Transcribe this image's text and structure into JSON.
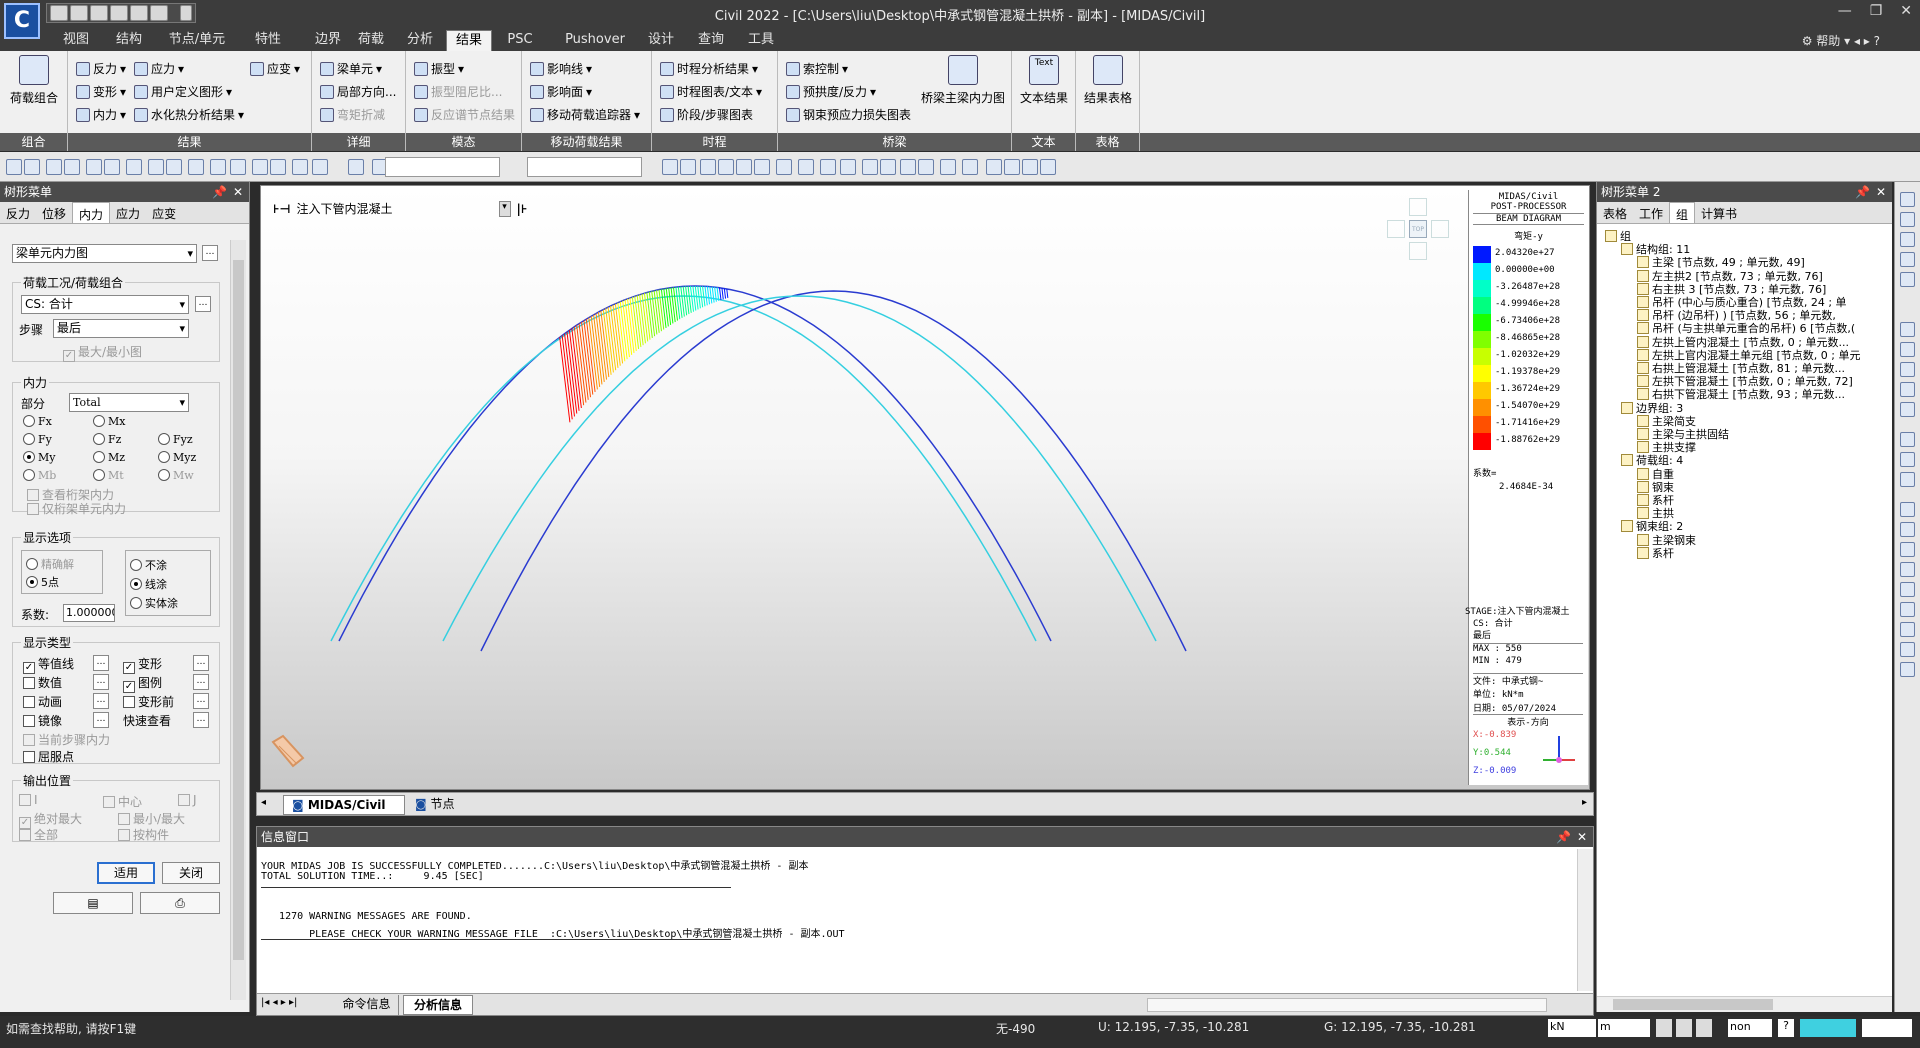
{
  "window": {
    "title": "Civil 2022 - [C:\\Users\\liu\\Desktop\\中承式钢管混凝土拱桥 - 副本] - [MIDAS/Civil]",
    "logo": "C"
  },
  "menu_tabs": [
    "视图",
    "结构",
    "节点/单元",
    "特性",
    "边界",
    "荷载",
    "分析",
    "结果",
    "PSC",
    "Pushover",
    "设计",
    "查询",
    "工具"
  ],
  "active_tab": "结果",
  "help_label": "帮助",
  "ribbon": {
    "groups": [
      {
        "label": "组合",
        "items": [
          "荷载组合"
        ]
      },
      {
        "label": "结果",
        "items": [
          "反力",
          "应力",
          "应变",
          "变形",
          "用户定义图形",
          "内力",
          "水化热分析结果"
        ]
      },
      {
        "label": "详细",
        "items": [
          "梁单元",
          "局部方向...",
          "弯矩折减"
        ]
      },
      {
        "label": "模态",
        "items": [
          "振型",
          "振型阻尼比...",
          "反应谱节点结果"
        ]
      },
      {
        "label": "移动荷载结果",
        "items": [
          "影响线",
          "影响面",
          "移动荷载追踪器"
        ]
      },
      {
        "label": "时程",
        "items": [
          "时程分析结果",
          "时程图表/文本",
          "阶段/步骤图表"
        ]
      },
      {
        "label": "桥梁",
        "items": [
          "索控制",
          "预拱度/反力",
          "钢束预应力损失图表",
          "桥梁主梁内力图"
        ]
      },
      {
        "label": "文本",
        "items": [
          "文本结果"
        ]
      },
      {
        "label": "表格",
        "items": [
          "结果表格"
        ]
      }
    ],
    "text_icon_label": "Text"
  },
  "left_panel": {
    "title": "树形菜单",
    "tabs": [
      "反力",
      "位移",
      "内力",
      "应力",
      "应变"
    ],
    "active_tab": "内力",
    "diagram_type": "梁单元内力图",
    "load_section": "荷载工况/荷载组合",
    "load_case": "CS: 合计",
    "step_label": "步骤",
    "step_value": "最后",
    "maxmin_label": "最大/最小图",
    "internal_force_label": "内力",
    "part_label": "部分",
    "part_value": "Total",
    "components": [
      "Fx",
      "Mx",
      "Fy",
      "Fz",
      "Fyz",
      "My",
      "Mz",
      "Myz",
      "Mb",
      "Mt",
      "Mw"
    ],
    "selected_component": "My",
    "truss_force": "查看桁架内力",
    "truss_only": "仅桁架单元内力",
    "display_options_label": "显示选项",
    "precise": "精确解",
    "five_points": "5点",
    "fill_none": "不涂",
    "fill_line": "线涂",
    "fill_solid": "实体涂",
    "scale_label": "系数:",
    "scale_value": "1.000000",
    "display_type_label": "显示类型",
    "contour": "等值线",
    "deformed": "变形",
    "values": "数值",
    "legend": "图例",
    "animation": "动画",
    "undeformed": "变形前",
    "mirror": "镜像",
    "quick_view": "快速查看",
    "current_step_force": "当前步骤内力",
    "yield_point": "屈服点",
    "output_position_label": "输出位置",
    "pos_i": "I",
    "pos_center": "中心",
    "pos_j": "J",
    "abs_max": "绝对最大",
    "min_max": "最小/最大",
    "all": "全部",
    "by_member": "按构件",
    "apply_btn": "适用",
    "close_btn": "关闭"
  },
  "toolbar": {
    "combo1": "",
    "combo2": ""
  },
  "viewport": {
    "stage_label": "注入下管内混凝土",
    "tabs": [
      "MIDAS/Civil",
      "节点"
    ],
    "active_tab": "MIDAS/Civil"
  },
  "legend_panel": {
    "header1": "MIDAS/Civil",
    "header2": "POST-PROCESSOR",
    "header3": "BEAM DIAGRAM",
    "component": "弯矩-y",
    "values": [
      "2.04320e+27",
      "0.00000e+00",
      "-3.26487e+28",
      "-4.99946e+28",
      "-6.73406e+28",
      "-8.46865e+28",
      "-1.02032e+29",
      "-1.19378e+29",
      "-1.36724e+29",
      "-1.54070e+29",
      "-1.71416e+29",
      "-1.88762e+29"
    ],
    "colors": [
      "#0019ff",
      "#00e8ff",
      "#00ffc8",
      "#00ff80",
      "#19ff00",
      "#80ff00",
      "#c8ff00",
      "#ffff00",
      "#ffc800",
      "#ff9000",
      "#ff5000",
      "#ff0000"
    ],
    "factor_label": "系数=",
    "factor_value": "2.4684E-34",
    "stage_line": "STAGE:注入下管内混凝土",
    "cs_line": "CS: 合计",
    "last_line": "最后",
    "max_line": "MAX : 550",
    "min_line": "MIN : 479",
    "file_line": "文件: 中承式钢~",
    "unit_line": "单位: kN*m",
    "date_line": "日期: 05/07/2024",
    "dir_line": "表示-方向",
    "x_dir": "X:-0.839",
    "y_dir": "Y:0.544",
    "z_dir": "Z:-0.009",
    "axis_colors": {
      "x": "#e05050",
      "y": "#30b030",
      "z": "#4040e0"
    }
  },
  "message_window": {
    "title": "信息窗口",
    "lines": [
      "YOUR MIDAS JOB IS SUCCESSFULLY COMPLETED.......C:\\Users\\liu\\Desktop\\中承式钢管混凝土拱桥 - 副本",
      "TOTAL SOLUTION TIME..:     9.45 [SEC]",
      "",
      "   1270 WARNING MESSAGES ARE FOUND.",
      "        PLEASE CHECK YOUR WARNING MESSAGE FILE  :C:\\Users\\liu\\Desktop\\中承式钢管混凝土拱桥 - 副本.OUT"
    ],
    "tabs": [
      "命令信息",
      "分析信息"
    ],
    "active_tab": "分析信息"
  },
  "right_panel": {
    "title": "树形菜单 2",
    "tabs": [
      "表格",
      "工作",
      "组",
      "计算书"
    ],
    "active_tab": "组",
    "tree": [
      {
        "level": 0,
        "label": "组"
      },
      {
        "level": 1,
        "label": "结构组: 11"
      },
      {
        "level": 2,
        "label": "主梁 [节点数, 49 ; 单元数, 49]"
      },
      {
        "level": 2,
        "label": "左主拱2 [节点数, 73 ; 单元数, 76]"
      },
      {
        "level": 2,
        "label": "右主拱 3 [节点数, 73 ; 单元数, 76]"
      },
      {
        "level": 2,
        "label": "吊杆 (中心与质心重合) [节点数, 24 ; 单"
      },
      {
        "level": 2,
        "label": "吊杆 (边吊杆) ) [节点数, 56 ; 单元数, "
      },
      {
        "level": 2,
        "label": "吊杆 (与主拱单元重合的吊杆) 6 [节点数,("
      },
      {
        "level": 2,
        "label": "左拱上管内混凝土 [节点数, 0 ; 单元数..."
      },
      {
        "level": 2,
        "label": "左拱上官内混凝土单元组 [节点数, 0 ; 单元"
      },
      {
        "level": 2,
        "label": "右拱上管混凝土 [节点数, 81 ; 单元数..."
      },
      {
        "level": 2,
        "label": "左拱下管混凝土 [节点数, 0 ; 单元数, 72]"
      },
      {
        "level": 2,
        "label": "右拱下管混凝土 [节点数, 93 ; 单元数..."
      },
      {
        "level": 1,
        "label": "边界组: 3"
      },
      {
        "level": 2,
        "label": "主梁简支"
      },
      {
        "level": 2,
        "label": "主梁与主拱固结"
      },
      {
        "level": 2,
        "label": "主拱支撑"
      },
      {
        "level": 1,
        "label": "荷载组: 4"
      },
      {
        "level": 2,
        "label": "自重"
      },
      {
        "level": 2,
        "label": "钢束"
      },
      {
        "level": 2,
        "label": "系杆"
      },
      {
        "level": 2,
        "label": "主拱"
      },
      {
        "level": 1,
        "label": "钢束组: 2"
      },
      {
        "level": 2,
        "label": "主梁钢束"
      },
      {
        "level": 2,
        "label": "系杆"
      }
    ]
  },
  "status": {
    "help_text": "如需查找帮助, 请按F1键",
    "element": "无-490",
    "ucs": "U: 12.195, -7.35, -10.281",
    "gcs": "G: 12.195, -7.35, -10.281",
    "unit_force": "kN",
    "unit_len": "m",
    "none_label": "non"
  }
}
